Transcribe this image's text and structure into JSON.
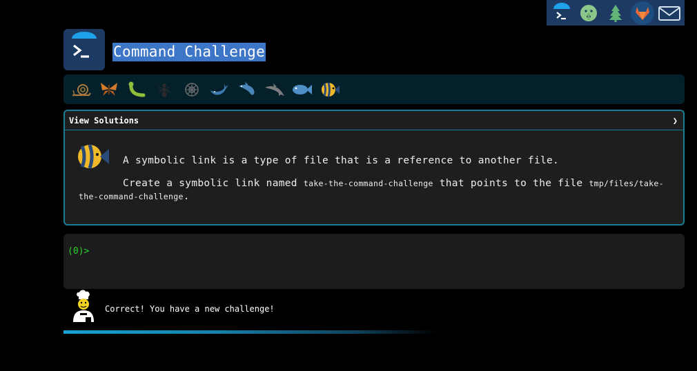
{
  "toolbar": {
    "items": [
      {
        "icon": "terminal-umbrella-icon",
        "active": false
      },
      {
        "icon": "shush-face-icon",
        "active": false
      },
      {
        "icon": "tree-icon",
        "active": false
      },
      {
        "icon": "gitlab-icon",
        "active": true
      },
      {
        "icon": "envelope-icon",
        "active": false
      }
    ]
  },
  "header": {
    "title": "Command Challenge"
  },
  "levels": [
    "snail-icon",
    "butterfly-icon",
    "caterpillar-icon",
    "ant-icon",
    "shell-icon",
    "whale-icon",
    "shark-icon",
    "dolphin-icon",
    "fish-icon",
    "tropical-fish-icon"
  ],
  "challenge": {
    "toggle_label": "View Solutions",
    "toggle_chevron": "❯",
    "line1": "A symbolic link is a type of file that is a reference to another file.",
    "line2_pre": "Create a symbolic link named ",
    "line2_code1": "take-the-command-challenge",
    "line2_mid": " that points to the file ",
    "line2_code2": "tmp/files/take-the-command-challenge",
    "line2_end": "."
  },
  "terminal": {
    "prompt": "(0)>"
  },
  "feedback": {
    "message": "Correct! You have a new challenge!"
  },
  "colors": {
    "accent": "#1a7d95",
    "title_highlight": "#3d76c7",
    "prompt_green": "#2bd32b",
    "toolbar_bg": "#1c3a62"
  }
}
